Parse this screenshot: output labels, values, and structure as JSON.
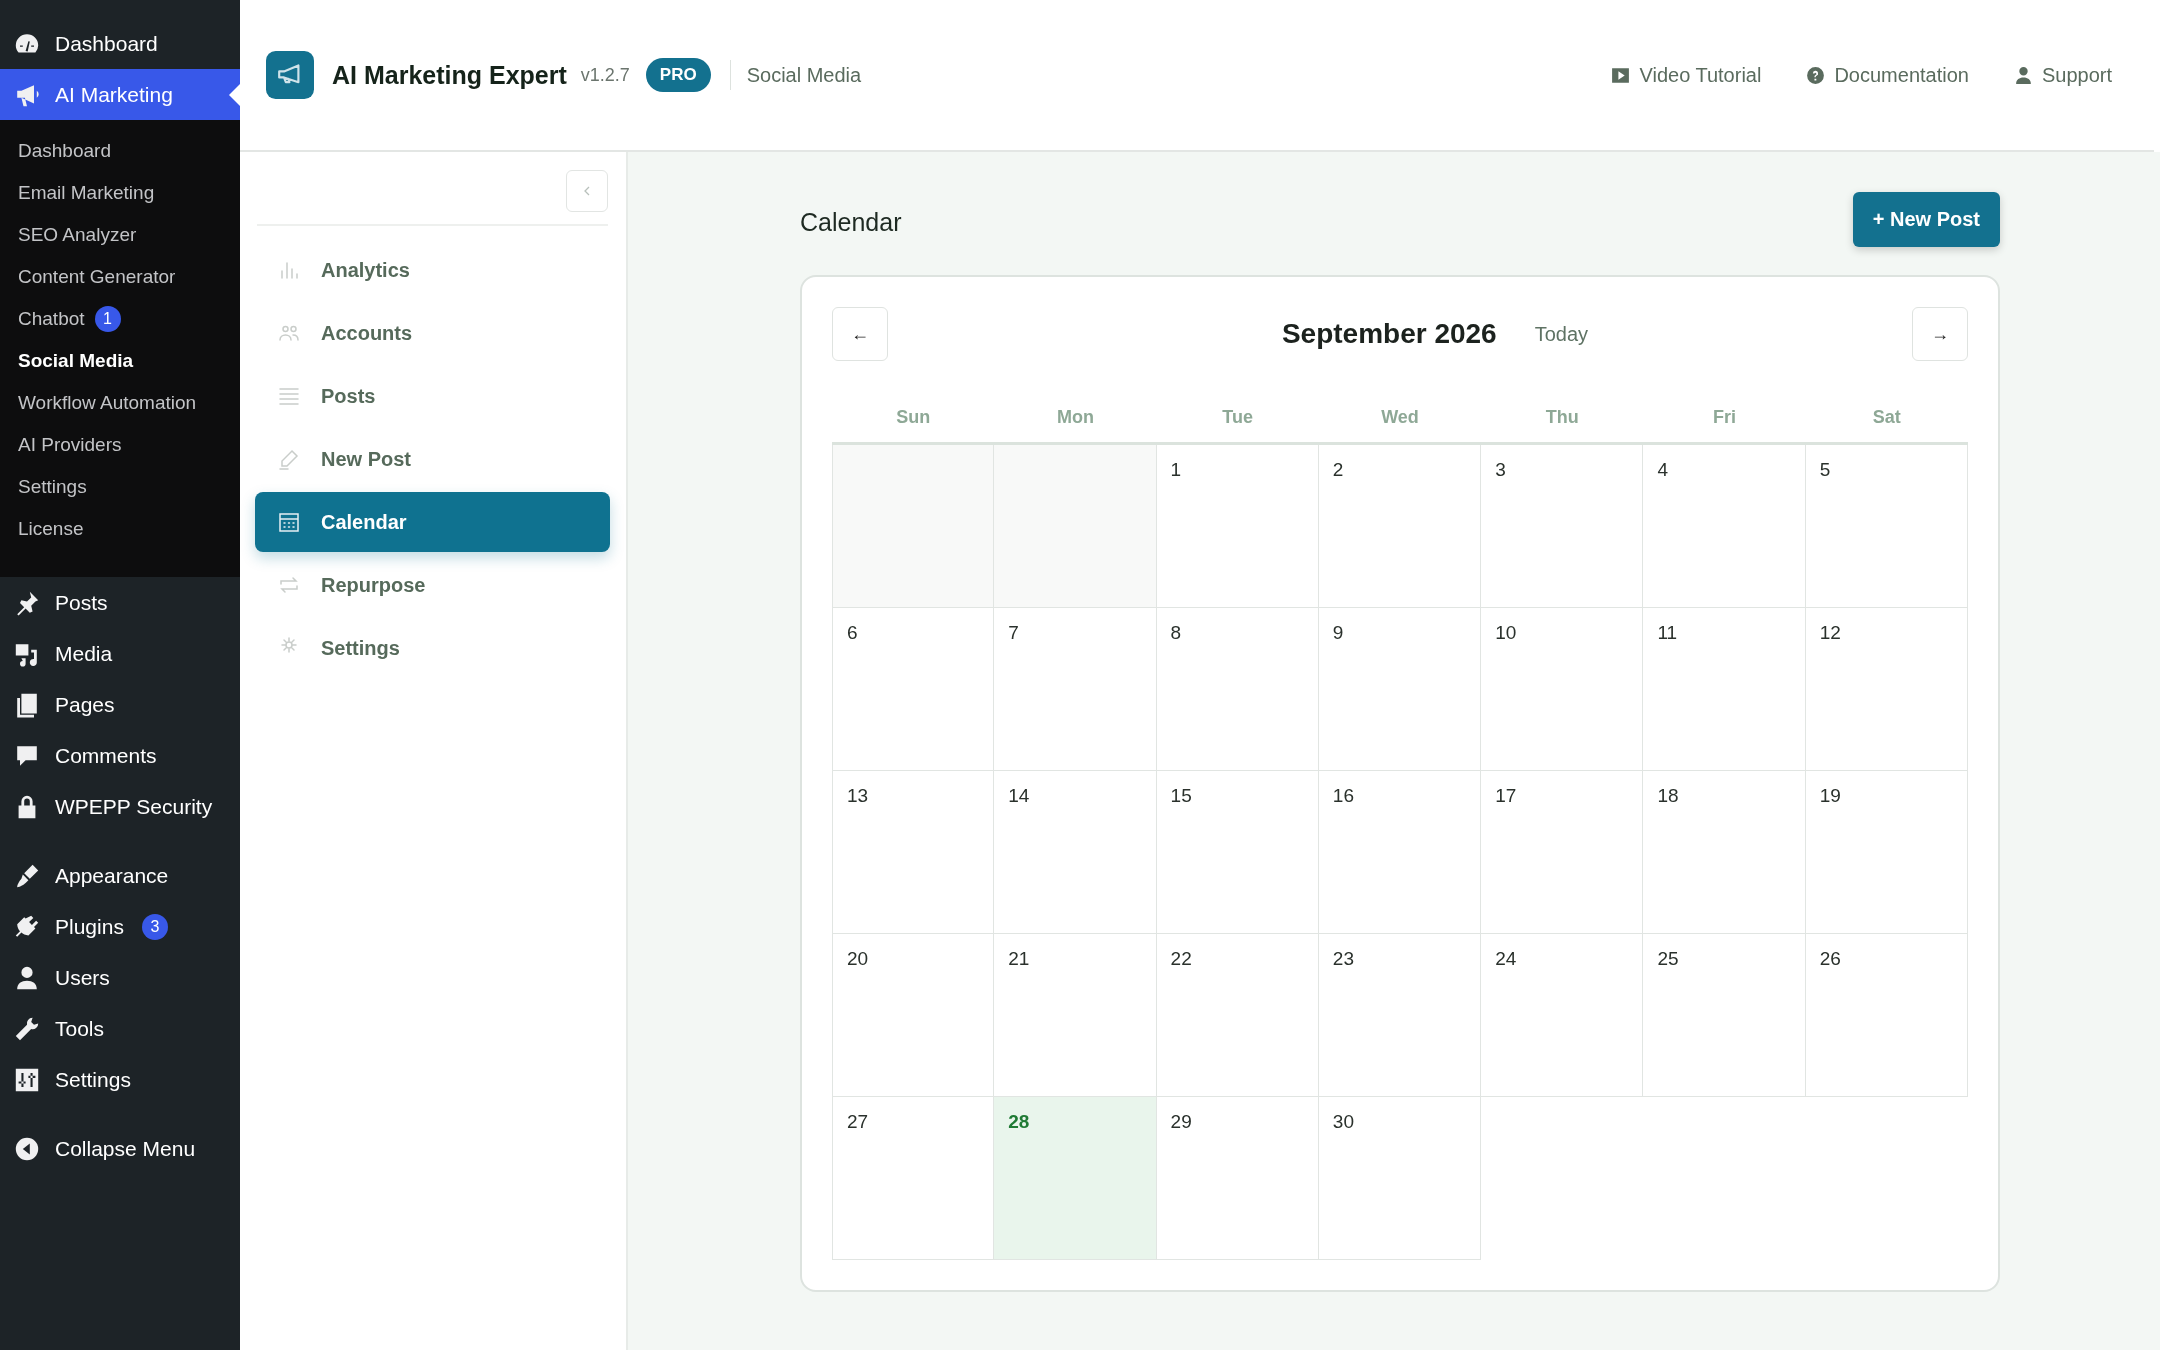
{
  "admin_menu": {
    "groups": [
      {
        "items": [
          {
            "label": "Dashboard",
            "selected": false
          },
          {
            "label": "AI Marketing",
            "selected": true,
            "submenu": [
              {
                "label": "Dashboard",
                "selected": false
              },
              {
                "label": "Email Marketing",
                "selected": false
              },
              {
                "label": "SEO Analyzer",
                "selected": false
              },
              {
                "label": "Content Generator",
                "selected": false
              },
              {
                "label": "Chatbot",
                "selected": false,
                "badge": "1"
              },
              {
                "label": "Social Media",
                "selected": true
              },
              {
                "label": "Workflow Automation",
                "selected": false
              },
              {
                "label": "AI Providers",
                "selected": false
              },
              {
                "label": "Settings",
                "selected": false
              },
              {
                "label": "License",
                "selected": false
              }
            ]
          },
          {
            "label": "Posts",
            "selected": false
          },
          {
            "label": "Media",
            "selected": false
          },
          {
            "label": "Pages",
            "selected": false
          },
          {
            "label": "Comments",
            "selected": false
          },
          {
            "label": "WPEPP Security",
            "selected": false
          }
        ]
      },
      {
        "items": [
          {
            "label": "Appearance",
            "selected": false
          },
          {
            "label": "Plugins",
            "selected": false,
            "badge": "3"
          },
          {
            "label": "Users",
            "selected": false
          },
          {
            "label": "Tools",
            "selected": false
          },
          {
            "label": "Settings",
            "selected": false
          }
        ]
      },
      {
        "items": [
          {
            "label": "Collapse Menu",
            "selected": false
          }
        ]
      }
    ]
  },
  "header": {
    "title": "AI Marketing Expert",
    "version": "v1.2.7",
    "badge": "PRO",
    "section": "Social Media",
    "links": [
      "Video Tutorial",
      "Documentation",
      "Support"
    ]
  },
  "subnav": {
    "items": [
      {
        "label": "Analytics",
        "selected": false
      },
      {
        "label": "Accounts",
        "selected": false
      },
      {
        "label": "Posts",
        "selected": false
      },
      {
        "label": "New Post",
        "selected": false
      },
      {
        "label": "Calendar",
        "selected": true
      },
      {
        "label": "Repurpose",
        "selected": false
      },
      {
        "label": "Settings",
        "selected": false
      }
    ]
  },
  "page_title": "Calendar",
  "new_post_button": "+ New Post",
  "calendar": {
    "prev": "←",
    "next": "→",
    "month": "September 2026",
    "today_button": "Today",
    "weekdays": [
      "Sun",
      "Mon",
      "Tue",
      "Wed",
      "Thu",
      "Fri",
      "Sat"
    ],
    "weeks": [
      {
        "days": [
          {
            "kind": "blank"
          },
          {
            "kind": "blank"
          },
          {
            "kind": "day",
            "label": "1",
            "today": false
          },
          {
            "kind": "day",
            "label": "2",
            "today": false
          },
          {
            "kind": "day",
            "label": "3",
            "today": false
          },
          {
            "kind": "day",
            "label": "4",
            "today": false
          },
          {
            "kind": "day",
            "label": "5",
            "today": false
          }
        ]
      },
      {
        "days": [
          {
            "kind": "day",
            "label": "6",
            "today": false
          },
          {
            "kind": "day",
            "label": "7",
            "today": false
          },
          {
            "kind": "day",
            "label": "8",
            "today": false
          },
          {
            "kind": "day",
            "label": "9",
            "today": false
          },
          {
            "kind": "day",
            "label": "10",
            "today": false
          },
          {
            "kind": "day",
            "label": "11",
            "today": false
          },
          {
            "kind": "day",
            "label": "12",
            "today": false
          }
        ]
      },
      {
        "days": [
          {
            "kind": "day",
            "label": "13",
            "today": false
          },
          {
            "kind": "day",
            "label": "14",
            "today": false
          },
          {
            "kind": "day",
            "label": "15",
            "today": false
          },
          {
            "kind": "day",
            "label": "16",
            "today": false
          },
          {
            "kind": "day",
            "label": "17",
            "today": false
          },
          {
            "kind": "day",
            "label": "18",
            "today": false
          },
          {
            "kind": "day",
            "label": "19",
            "today": false
          }
        ]
      },
      {
        "days": [
          {
            "kind": "day",
            "label": "20",
            "today": false
          },
          {
            "kind": "day",
            "label": "21",
            "today": false
          },
          {
            "kind": "day",
            "label": "22",
            "today": false
          },
          {
            "kind": "day",
            "label": "23",
            "today": false
          },
          {
            "kind": "day",
            "label": "24",
            "today": false
          },
          {
            "kind": "day",
            "label": "25",
            "today": false
          },
          {
            "kind": "day",
            "label": "26",
            "today": false
          }
        ]
      },
      {
        "days": [
          {
            "kind": "day",
            "label": "27",
            "today": false
          },
          {
            "kind": "day",
            "label": "28",
            "today": true
          },
          {
            "kind": "day",
            "label": "29",
            "today": false
          },
          {
            "kind": "day",
            "label": "30",
            "today": false
          }
        ]
      }
    ]
  }
}
